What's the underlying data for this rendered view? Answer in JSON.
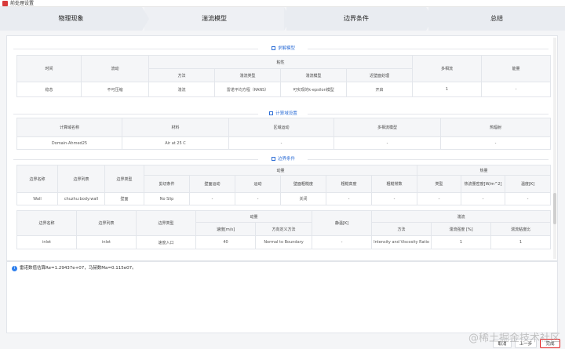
{
  "window": {
    "title": "前处理设置"
  },
  "steps": [
    "物理现象",
    "湍流模型",
    "边界条件",
    "总结"
  ],
  "sections": {
    "solver_model": {
      "title": "求解模型",
      "group_header": "粘性",
      "headers_top": [
        "时间",
        "流动",
        "多相流",
        "能量"
      ],
      "headers_sub": [
        "方法",
        "湍流类型",
        "湍流模型",
        "近壁面处理"
      ],
      "row": [
        "稳态",
        "不可压缩",
        "湍流",
        "雷诺平均方程（RANS）",
        "可实现的k-epsilon模型",
        "开启",
        "1",
        "-"
      ]
    },
    "domain": {
      "title": "计算域设置",
      "headers": [
        "计算域名称",
        "材料",
        "区域运动",
        "多相流模型",
        "热辐射"
      ],
      "row": [
        "Domain-Ahmed25",
        "Air at 25 C",
        "-",
        "-",
        "-"
      ]
    },
    "boundary": {
      "title": "边界条件",
      "wall": {
        "headers_top": [
          "边界名称",
          "边界列表",
          "边界类型",
          "动量",
          "热量"
        ],
        "headers_sub": [
          "剪切条件",
          "壁面运动",
          "运动",
          "壁面粗糙度",
          "粗糙高度",
          "粗糙常数",
          "类型",
          "热流量密度[W/m^2]",
          "温度[K]"
        ],
        "row": [
          "Wall",
          "chuzhu:body:wall",
          "壁面",
          "No Slip",
          "-",
          "-",
          "关闭",
          "-",
          "-",
          "-",
          "-",
          "-"
        ]
      },
      "inlet": {
        "headers_top": [
          "边界名称",
          "边界列表",
          "边界类型",
          "动量",
          "静温[K]",
          "湍流"
        ],
        "headers_sub": [
          "速度[m/s]",
          "方向定义方法",
          "方法",
          "湍流强度 [%]",
          "湍流粘度比"
        ],
        "row": [
          "inlet",
          "inlet",
          "速度入口",
          "40",
          "Normal to Boundary",
          "-",
          "Intensity and Viscosity Ratio",
          "1",
          "1"
        ]
      }
    }
  },
  "log": {
    "message": "雷诺数值估算Re=1.29437e+07，马赫数Ma=0.115e07。"
  },
  "footer": {
    "buttons": [
      "取消",
      "上一步",
      "完成"
    ]
  },
  "watermark": "@稀土掘金技术社区",
  "colors": {
    "accent": "#2f6fd6",
    "highlight": "#e02020"
  }
}
